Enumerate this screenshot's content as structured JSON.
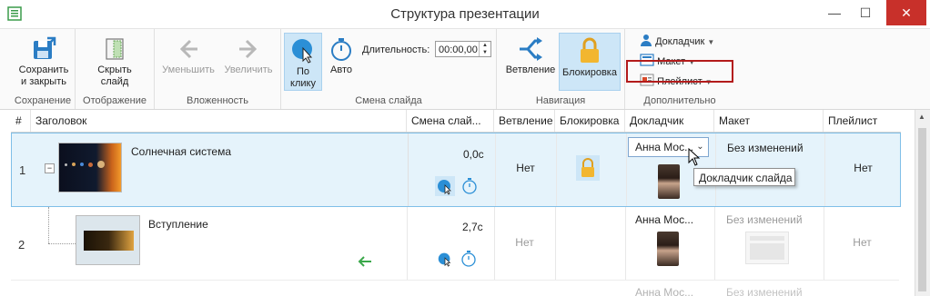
{
  "window": {
    "title": "Структура презентации",
    "minimize": "—",
    "maximize": "☐",
    "close": "✕"
  },
  "ribbon": {
    "groups": {
      "save": {
        "label": "Сохранение",
        "save_close": "Сохранить и закрыть"
      },
      "display": {
        "label": "Отображение",
        "hide_slide": "Скрыть слайд"
      },
      "nesting": {
        "label": "Вложенность",
        "decrease": "Уменьшить",
        "increase": "Увеличить"
      },
      "slide_change": {
        "label": "Смена слайда",
        "on_click": "По клику",
        "auto": "Авто",
        "duration_label": "Длительность:",
        "duration_value": "00:00,00"
      },
      "navigation": {
        "label": "Навигация",
        "branching": "Ветвление",
        "lock": "Блокировка"
      },
      "additional": {
        "label": "Дополнительно",
        "presenter": "Докладчик",
        "layout": "Макет",
        "playlist": "Плейлист"
      }
    }
  },
  "grid": {
    "columns": {
      "num": "#",
      "title": "Заголовок",
      "slide_change": "Смена слай...",
      "branching": "Ветвление",
      "lock": "Блокировка",
      "presenter": "Докладчик",
      "layout": "Макет",
      "playlist": "Плейлист"
    },
    "rows": [
      {
        "num": "1",
        "title": "Солнечная система",
        "time": "0,0c",
        "branching": "Нет",
        "presenter": "Анна Мос...",
        "layout": "Без изменений",
        "playlist": "Нет"
      },
      {
        "num": "2",
        "title": "Вступление",
        "time": "2,7c",
        "branching": "Нет",
        "presenter": "Анна Мос...",
        "layout": "Без изменений",
        "playlist": "Нет"
      },
      {
        "presenter": "Анна Мос...",
        "layout": "Без изменений"
      }
    ],
    "expander": "−",
    "combo_arrow": "⌄"
  },
  "tooltip": "Докладчик слайда",
  "colors": {
    "accent": "#2b8fd6",
    "selected_bg": "#e5f3fb",
    "highlight": "#b31b1b",
    "lock": "#f2b630",
    "close": "#c8302a"
  }
}
